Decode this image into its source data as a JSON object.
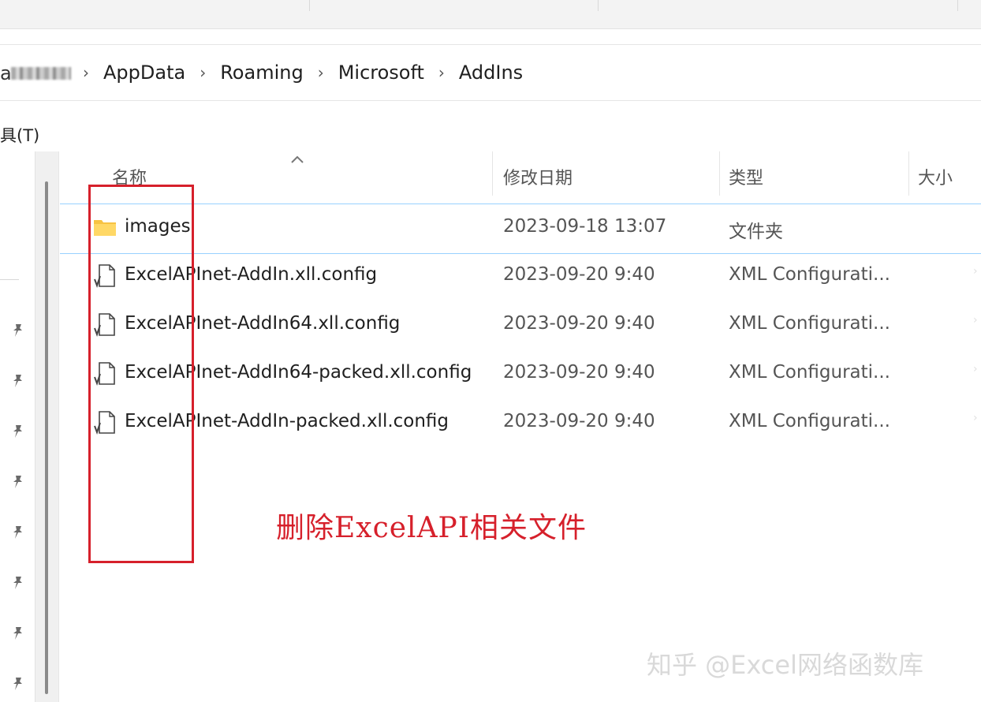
{
  "breadcrumb": {
    "obscured_prefix": "a",
    "items": [
      "AppData",
      "Roaming",
      "Microsoft",
      "AddIns"
    ],
    "separator": "›"
  },
  "menubar": {
    "tools_label": "具(T)"
  },
  "columns": {
    "name": "名称",
    "date": "修改日期",
    "type": "类型",
    "size": "大小"
  },
  "files": [
    {
      "name": "images",
      "date": "2023-09-18 13:07",
      "type": "文件夹",
      "icon": "folder-icon"
    },
    {
      "name": "ExcelAPInet-AddIn.xll.config",
      "date": "2023-09-20 9:40",
      "type": "XML Configurati...",
      "icon": "config-file-icon"
    },
    {
      "name": "ExcelAPInet-AddIn64.xll.config",
      "date": "2023-09-20 9:40",
      "type": "XML Configurati...",
      "icon": "config-file-icon"
    },
    {
      "name": "ExcelAPInet-AddIn64-packed.xll.config",
      "date": "2023-09-20 9:40",
      "type": "XML Configurati...",
      "icon": "config-file-icon"
    },
    {
      "name": "ExcelAPInet-AddIn-packed.xll.config",
      "date": "2023-09-20 9:40",
      "type": "XML Configurati...",
      "icon": "config-file-icon"
    }
  ],
  "annotation": {
    "text": "删除ExcelAPI相关文件",
    "color": "#d6202b"
  },
  "watermark": {
    "text": "知乎 @Excel网络函数库"
  },
  "colors": {
    "selection_border": "#99d1ff",
    "folder": "#f7c343",
    "annotation_red": "#d6202b"
  }
}
